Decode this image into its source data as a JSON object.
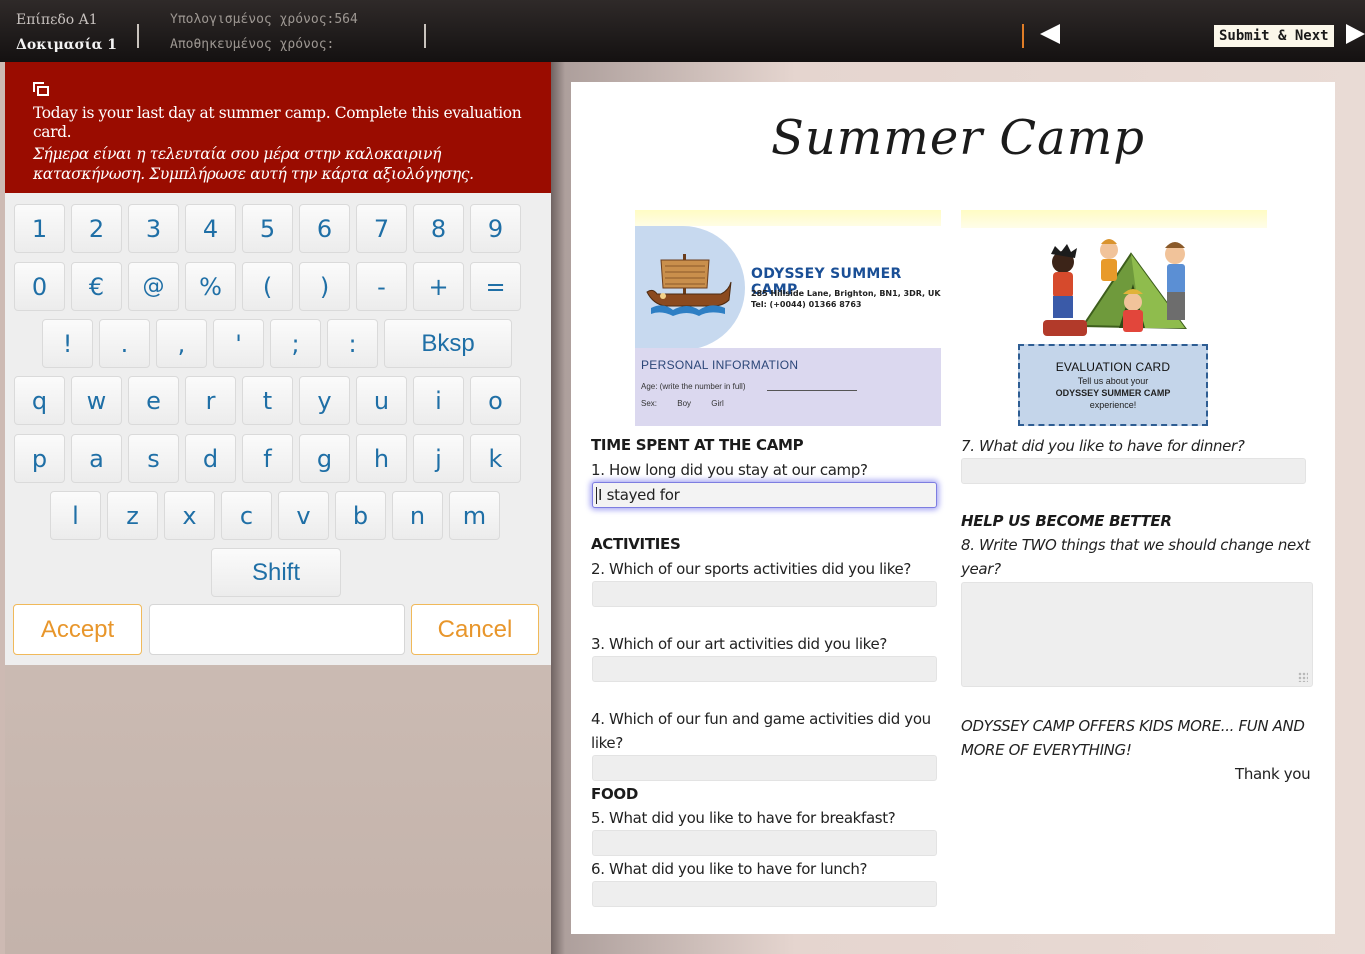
{
  "topbar": {
    "level": "Επίπεδο Α1",
    "task": "Δοκιμασία 1",
    "calculated_time": "Υπολογισμένος χρόνος:564",
    "saved_time": "Αποθηκευμένος χρόνος:",
    "submit_label": "Submit & Next"
  },
  "instructions": {
    "english": "Today is your last day at summer camp. Complete this evaluation card.",
    "greek": "Σήμερα είναι η τελευταία σου μέρα στην καλοκαιρινή κατασκήνωση. Συμπλήρωσε αυτή την κάρτα αξιολόγησης."
  },
  "keyboard": {
    "row1": [
      "1",
      "2",
      "3",
      "4",
      "5",
      "6",
      "7",
      "8",
      "9"
    ],
    "row2": [
      "0",
      "€",
      "@",
      "%",
      "(",
      ")",
      "-",
      "+",
      "="
    ],
    "row3": [
      "!",
      ".",
      ",",
      "'",
      ";",
      ":"
    ],
    "backspace": "Bksp",
    "row4": [
      "q",
      "w",
      "e",
      "r",
      "t",
      "y",
      "u",
      "i",
      "o"
    ],
    "row5": [
      "p",
      "a",
      "s",
      "d",
      "f",
      "g",
      "h",
      "j",
      "k"
    ],
    "row6": [
      "l",
      "z",
      "x",
      "c",
      "v",
      "b",
      "n",
      "m"
    ],
    "shift": "Shift",
    "accept": "Accept",
    "cancel": "Cancel",
    "input_value": ""
  },
  "form": {
    "title": "Summer Camp",
    "leaflet": {
      "brand": "ODYSSEY SUMMER CAMP",
      "address": "285 Hillside Lane, Brighton,  BN1, 3DR, UK",
      "tel": "Tel: (+0044) 01366 8763",
      "personal_info": "PERSONAL INFORMATION",
      "age": "Age: (write the number in full)",
      "sex": "Sex:",
      "boy": "Boy",
      "girl": "Girl",
      "eval_title": "EVALUATION CARD",
      "eval_line1": "Tell us about your",
      "eval_line2": "ODYSSEY SUMMER CAMP",
      "eval_line3": "experience!"
    },
    "sections": {
      "time": "TIME SPENT AT THE CAMP",
      "activities": "ACTIVITIES",
      "food": "FOOD",
      "help": "HELP US BECOME BETTER"
    },
    "questions": {
      "q1": "1. How long did you stay at our camp?",
      "q2": "2. Which of our sports activities did you like?",
      "q3": "3. Which of our art activities did you like?",
      "q4": "4. Which of our fun and game activities did you like?",
      "q5": "5. What did you like to have for breakfast?",
      "q6": "6. What did you like to have for lunch?",
      "q7": "7. What did you like to have for dinner?",
      "q8": "8.  Write TWO things that we should change next year?"
    },
    "answers": {
      "q1": "I stayed for"
    },
    "closing": "ODYSSEY CAMP OFFERS KIDS MORE... FUN AND MORE OF EVERYTHING!",
    "thanks": "Thank you"
  }
}
